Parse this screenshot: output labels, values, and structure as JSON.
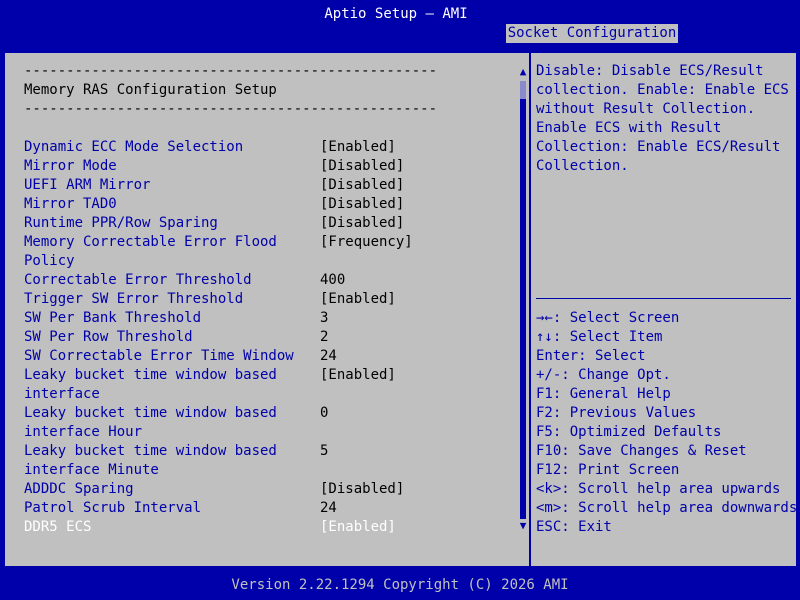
{
  "title": "Aptio Setup – AMI",
  "active_tab": "Socket Configuration",
  "page": {
    "dash_line": "-------------------------------------------------",
    "heading": "Memory RAS Configuration Setup"
  },
  "settings": [
    {
      "label": "Dynamic ECC Mode Selection",
      "value": "[Enabled]"
    },
    {
      "label": "Mirror Mode",
      "value": "[Disabled]"
    },
    {
      "label": "UEFI ARM Mirror",
      "value": "[Disabled]"
    },
    {
      "label": "Mirror TAD0",
      "value": "[Disabled]"
    },
    {
      "label": "Runtime PPR/Row Sparing",
      "value": "[Disabled]"
    },
    {
      "label": "Memory Correctable Error Flood",
      "label2": "Policy",
      "value": "[Frequency]"
    },
    {
      "label": "Correctable Error Threshold",
      "value": "400"
    },
    {
      "label": "Trigger SW Error Threshold",
      "value": "[Enabled]"
    },
    {
      "label": "SW Per Bank Threshold",
      "value": "3"
    },
    {
      "label": "SW Per Row Threshold",
      "value": "2"
    },
    {
      "label": "SW Correctable Error Time Window",
      "value": "24"
    },
    {
      "label": "Leaky bucket time window based",
      "label2": "interface",
      "value": "[Enabled]"
    },
    {
      "label": "Leaky bucket time window based",
      "label2": "interface Hour",
      "value": "0"
    },
    {
      "label": "Leaky bucket time window based",
      "label2": "interface Minute",
      "value": "5"
    },
    {
      "label": "ADDDC Sparing",
      "value": "[Disabled]"
    },
    {
      "label": "Patrol Scrub Interval",
      "value": "24"
    },
    {
      "label": "DDR5 ECS",
      "value": "[Enabled]"
    }
  ],
  "help_text": [
    "Disable: Disable ECS/Result",
    "collection. Enable: Enable ECS",
    "without Result Collection.",
    "Enable ECS with Result",
    "Collection: Enable ECS/Result",
    "Collection."
  ],
  "key_help": [
    "→←: Select Screen",
    "↑↓: Select Item",
    "Enter: Select",
    "+/-: Change Opt.",
    "F1: General Help",
    "F2: Previous Values",
    "F5: Optimized Defaults",
    "F10: Save Changes & Reset",
    "F12: Print Screen",
    "<k>: Scroll help area upwards",
    "<m>: Scroll help area downwards",
    "ESC: Exit"
  ],
  "scrollbar": {
    "up_arrow": "▲",
    "down_arrow": "▼"
  },
  "footer": "Version 2.22.1294 Copyright (C) 2026 AMI"
}
